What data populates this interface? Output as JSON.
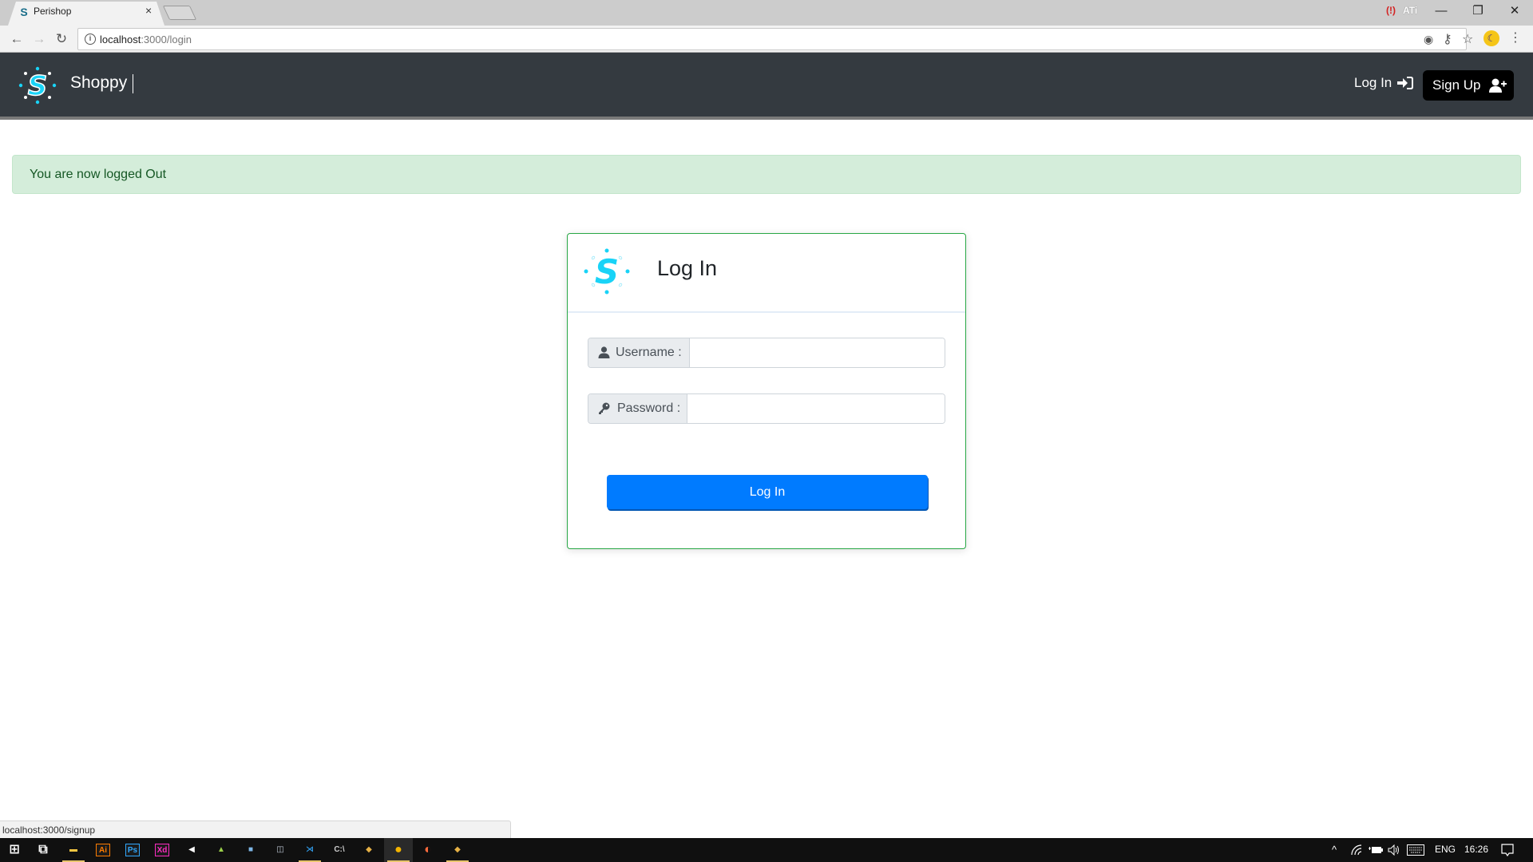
{
  "browser": {
    "tab_title": "Perishop",
    "tab_favicon": "S",
    "tab_close": "×",
    "url_host": "localhost",
    "url_path": ":3000/login",
    "extension_label": "ATi",
    "icons": {
      "back": "back-arrow-icon",
      "forward": "forward-arrow-icon",
      "reload": "reload-icon",
      "info": "site-info-icon",
      "location": "location-icon",
      "key": "key-icon",
      "star": "bookmark-star-icon",
      "extension": "night-mode-extension-icon",
      "menu": "kebab-menu-icon"
    },
    "glyphs": {
      "back": "←",
      "forward": "→",
      "reload": "↻",
      "info": "i",
      "location": "◉",
      "key": "⚷",
      "star": "☆",
      "moon": "☾",
      "menu": "⋮",
      "minimize": "—",
      "restore": "❐",
      "close": "✕",
      "ext_sync": "(!)"
    }
  },
  "navbar": {
    "brand": "Shoppy",
    "login_label": "Log In",
    "signup_label": "Sign Up",
    "bg_color": "#343a40"
  },
  "alert": {
    "message": "You are now logged Out",
    "type": "success"
  },
  "login_card": {
    "title": "Log In",
    "username": {
      "label": "Username :",
      "value": "",
      "placeholder": ""
    },
    "password": {
      "label": "Password :",
      "value": "",
      "placeholder": ""
    },
    "submit_label": "Log In",
    "accent_color": "#28a745",
    "button_color": "#007bff"
  },
  "status_bar": {
    "hover_url": "localhost:3000/signup"
  },
  "taskbar": {
    "apps": [
      {
        "name": "start",
        "glyph": "⊞",
        "color": "#ffffff"
      },
      {
        "name": "task-view",
        "glyph": "⧉",
        "color": "#ffffff"
      },
      {
        "name": "file-explorer",
        "glyph": "▬",
        "color": "#f4c542"
      },
      {
        "name": "adobe-illustrator",
        "glyph": "Ai",
        "color": "#ff7c00"
      },
      {
        "name": "adobe-photoshop",
        "glyph": "Ps",
        "color": "#31a8ff"
      },
      {
        "name": "adobe-xd",
        "glyph": "Xd",
        "color": "#ff2bc2"
      },
      {
        "name": "unity",
        "glyph": "◀",
        "color": "#ffffff"
      },
      {
        "name": "android-studio",
        "glyph": "▲",
        "color": "#9bd04a"
      },
      {
        "name": "virtualbox",
        "glyph": "■",
        "color": "#7eb6e6"
      },
      {
        "name": "resource-monitor",
        "glyph": "◫",
        "color": "#bfc9d6"
      },
      {
        "name": "vscode",
        "glyph": "⋊",
        "color": "#2f95e0"
      },
      {
        "name": "command-prompt",
        "glyph": "C:\\",
        "color": "#cccccc"
      },
      {
        "name": "git-gui",
        "glyph": "◆",
        "color": "#e6b146"
      },
      {
        "name": "chrome",
        "glyph": "●",
        "color": "#f4b400"
      },
      {
        "name": "app-orange",
        "glyph": "◐",
        "color": "#ff6b3d"
      },
      {
        "name": "git-bash",
        "glyph": "◆",
        "color": "#e6b146"
      }
    ],
    "tray": {
      "language": "ENG",
      "time": "16:26",
      "chevron": "^",
      "wifi": "wifi-icon",
      "battery": "battery-icon",
      "volume": "volume-icon",
      "keyboard": "keyboard-icon",
      "notifications": "action-center-icon"
    }
  }
}
